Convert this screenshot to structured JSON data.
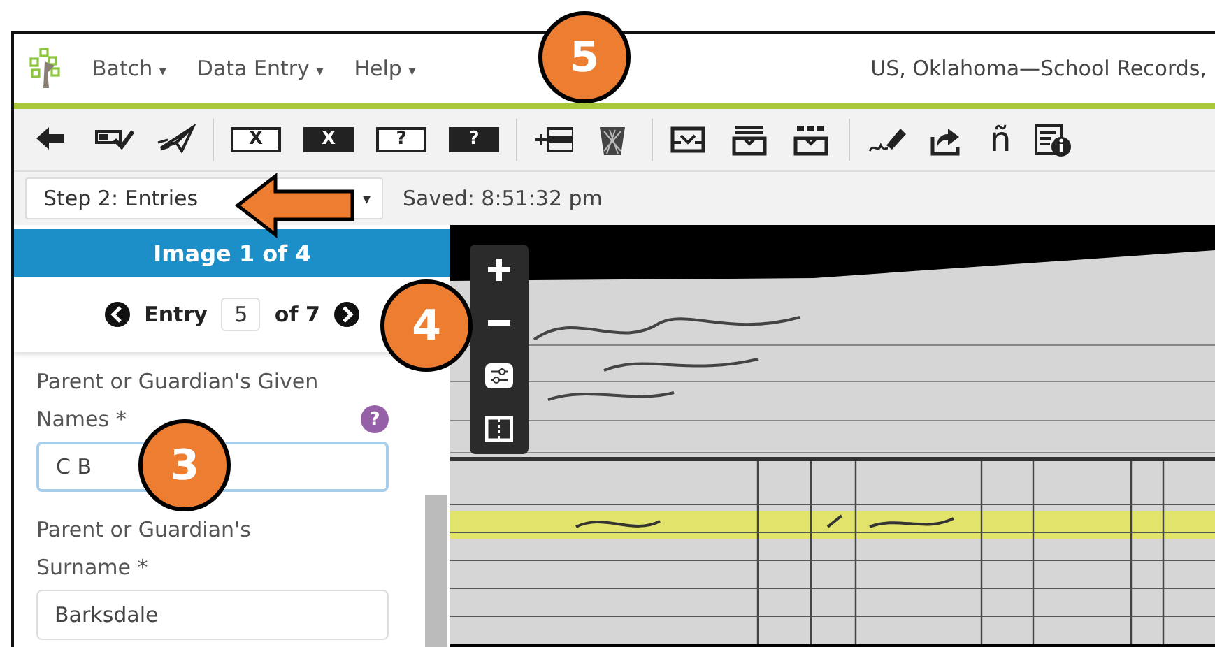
{
  "menu": [
    {
      "label": "Batch",
      "caret": "▾"
    },
    {
      "label": "Data Entry",
      "caret": "▾"
    },
    {
      "label": "Help",
      "caret": "▾"
    }
  ],
  "collection_title": "US, Oklahoma—School Records,",
  "toolbar": [
    [
      {
        "kind": "back"
      },
      {
        "kind": "check-row"
      },
      {
        "kind": "send"
      }
    ],
    [
      {
        "kind": "bracket",
        "glyph": "X",
        "filled": false
      },
      {
        "kind": "bracket",
        "glyph": "X",
        "filled": true
      },
      {
        "kind": "bracket",
        "glyph": "?",
        "filled": false
      },
      {
        "kind": "bracket",
        "glyph": "?",
        "filled": true
      }
    ],
    [
      {
        "kind": "add-row"
      },
      {
        "kind": "trash"
      }
    ],
    [
      {
        "kind": "tray-in"
      },
      {
        "kind": "tray-list"
      },
      {
        "kind": "tray-split"
      }
    ],
    [
      {
        "kind": "pen"
      },
      {
        "kind": "share"
      },
      {
        "kind": "char",
        "glyph": "ñ"
      },
      {
        "kind": "info"
      }
    ]
  ],
  "step": {
    "value": "Step 2: Entries",
    "caret": "▾"
  },
  "saved": "Saved: 8:51:32 pm",
  "image_header": "Image 1 of 4",
  "entry_nav": {
    "label": "Entry",
    "value": "5",
    "of": "of 7"
  },
  "fields": [
    {
      "label": "Parent or Guardian's Given Names *",
      "value": "C B",
      "focused": true,
      "help": "?"
    },
    {
      "label": "Parent or Guardian's Surname *",
      "value": "Barksdale",
      "focused": false
    }
  ],
  "viewer_controls": [
    {
      "kind": "zoom-in"
    },
    {
      "kind": "zoom-out"
    },
    {
      "kind": "adjust"
    },
    {
      "kind": "layout"
    }
  ],
  "viewer": {
    "kind": "picture"
  },
  "callouts": [
    {
      "kind": "badge",
      "number": "5"
    },
    {
      "kind": "badge",
      "number": "4"
    },
    {
      "kind": "badge",
      "number": "3"
    },
    {
      "kind": "arrow"
    }
  ]
}
